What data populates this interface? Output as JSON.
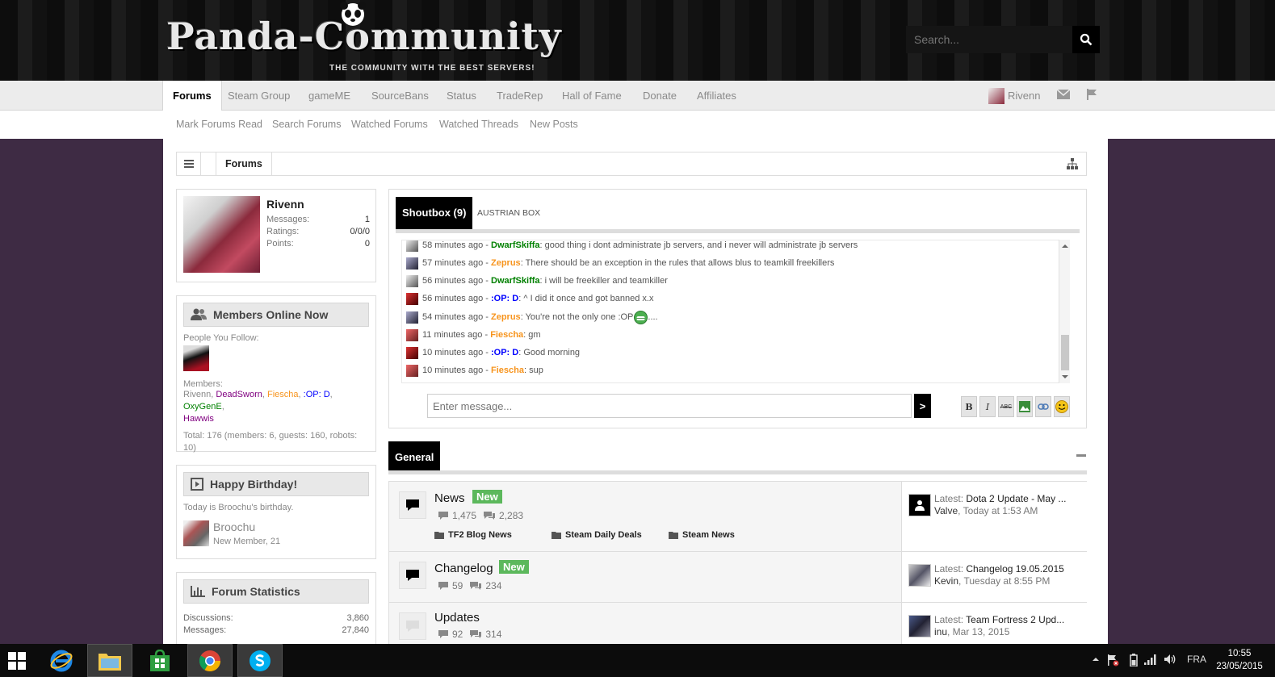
{
  "header": {
    "logo_text": "Panda-Community",
    "logo_sub": "THE COMMUNITY WITH THE BEST SERVERS!",
    "search_placeholder": "Search..."
  },
  "nav": {
    "items": [
      "Forums",
      "Steam Group",
      "gameME",
      "SourceBans",
      "Status",
      "TradeRep",
      "Hall of Fame",
      "Donate",
      "Affiliates"
    ],
    "user": "Rivenn"
  },
  "subnav": [
    "Mark Forums Read",
    "Search Forums",
    "Watched Forums",
    "Watched Threads",
    "New Posts"
  ],
  "breadcrumb": {
    "current": "Forums"
  },
  "visitor": {
    "name": "Rivenn",
    "stats": [
      {
        "label": "Messages:",
        "value": "1"
      },
      {
        "label": "Ratings:",
        "value": "0/0/0"
      },
      {
        "label": "Points:",
        "value": "0"
      }
    ]
  },
  "members_online": {
    "title": "Members Online Now",
    "follow_label": "People You Follow:",
    "members_label": "Members:",
    "members": [
      {
        "name": "Rivenn",
        "color": "#888888"
      },
      {
        "name": "DeadSworn",
        "color": "#800080"
      },
      {
        "name": "Fiescha",
        "color": "#f7941d"
      },
      {
        "name": ":OP: D",
        "color": "#0000ff"
      },
      {
        "name": "OxyGenE",
        "color": "#008000"
      },
      {
        "name": "Hawwis",
        "color": "#800080"
      }
    ],
    "total": "Total: 176 (members: 6, guests: 160, robots: 10)"
  },
  "birthday": {
    "title": "Happy Birthday!",
    "text": "Today is Broochu's birthday.",
    "name": "Broochu",
    "detail": "New Member, 21"
  },
  "stats": {
    "title": "Forum Statistics",
    "rows": [
      {
        "label": "Discussions:",
        "value": "3,860"
      },
      {
        "label": "Messages:",
        "value": "27,840"
      }
    ]
  },
  "shoutbox": {
    "tab_active": "Shoutbox (9)",
    "tab_other": "AUSTRIAN BOX",
    "input_placeholder": "Enter message...",
    "send_label": ">",
    "tools": [
      "B",
      "I",
      "ABC"
    ],
    "messages": [
      {
        "time": "58 minutes ago",
        "user": "DwarfSkiffa",
        "color": "#008000",
        "text": ": good thing i dont administrate jb servers, and i never will administrate jb servers"
      },
      {
        "time": "57 minutes ago",
        "user": "Zeprus",
        "color": "#f7941d",
        "text": ": There should be an exception in the rules that allows blus to teamkill freekillers"
      },
      {
        "time": "56 minutes ago",
        "user": "DwarfSkiffa",
        "color": "#008000",
        "text": ": i will be freekiller and teamkiller"
      },
      {
        "time": "56 minutes ago",
        "user": ":OP: D",
        "color": "#0000ff",
        "text": ": ^ I did it once and got banned x.x"
      },
      {
        "time": "54 minutes ago",
        "user": "Zeprus",
        "color": "#f7941d",
        "text": ": You're not the only one :OP",
        "suffix": "...."
      },
      {
        "time": "11 minutes ago",
        "user": "Fiescha",
        "color": "#f7941d",
        "text": ": gm"
      },
      {
        "time": "10 minutes ago",
        "user": ":OP: D",
        "color": "#0000ff",
        "text": ": Good morning"
      },
      {
        "time": "10 minutes ago",
        "user": "Fiescha",
        "color": "#f7941d",
        "text": ": sup"
      }
    ]
  },
  "general": {
    "title": "General",
    "forums": [
      {
        "title": "News",
        "new": "New",
        "threads": "1,475",
        "posts": "2,283",
        "latest_label": "Latest:",
        "latest_title": "Dota 2 Update - May ...",
        "latest_user": "Valve",
        "latest_time": ", Today at 1:53 AM",
        "subforums": [
          "TF2 Blog News",
          "Steam Daily Deals",
          "Steam News"
        ]
      },
      {
        "title": "Changelog",
        "new": "New",
        "threads": "59",
        "posts": "234",
        "latest_label": "Latest:",
        "latest_title": "Changelog 19.05.2015",
        "latest_user": "Kevin",
        "latest_time": ", Tuesday at 8:55 PM"
      },
      {
        "title": "Updates",
        "threads": "92",
        "posts": "314",
        "latest_label": "Latest:",
        "latest_title": "Team Fortress 2 Upd...",
        "latest_user": "inu",
        "latest_time": ", Mar 13, 2015"
      }
    ]
  },
  "taskbar": {
    "lang": "FRA",
    "time": "10:55",
    "date": "23/05/2015"
  },
  "colors": {
    "accent_new": "#5cb85c",
    "page_bg": "#3e2b44"
  }
}
